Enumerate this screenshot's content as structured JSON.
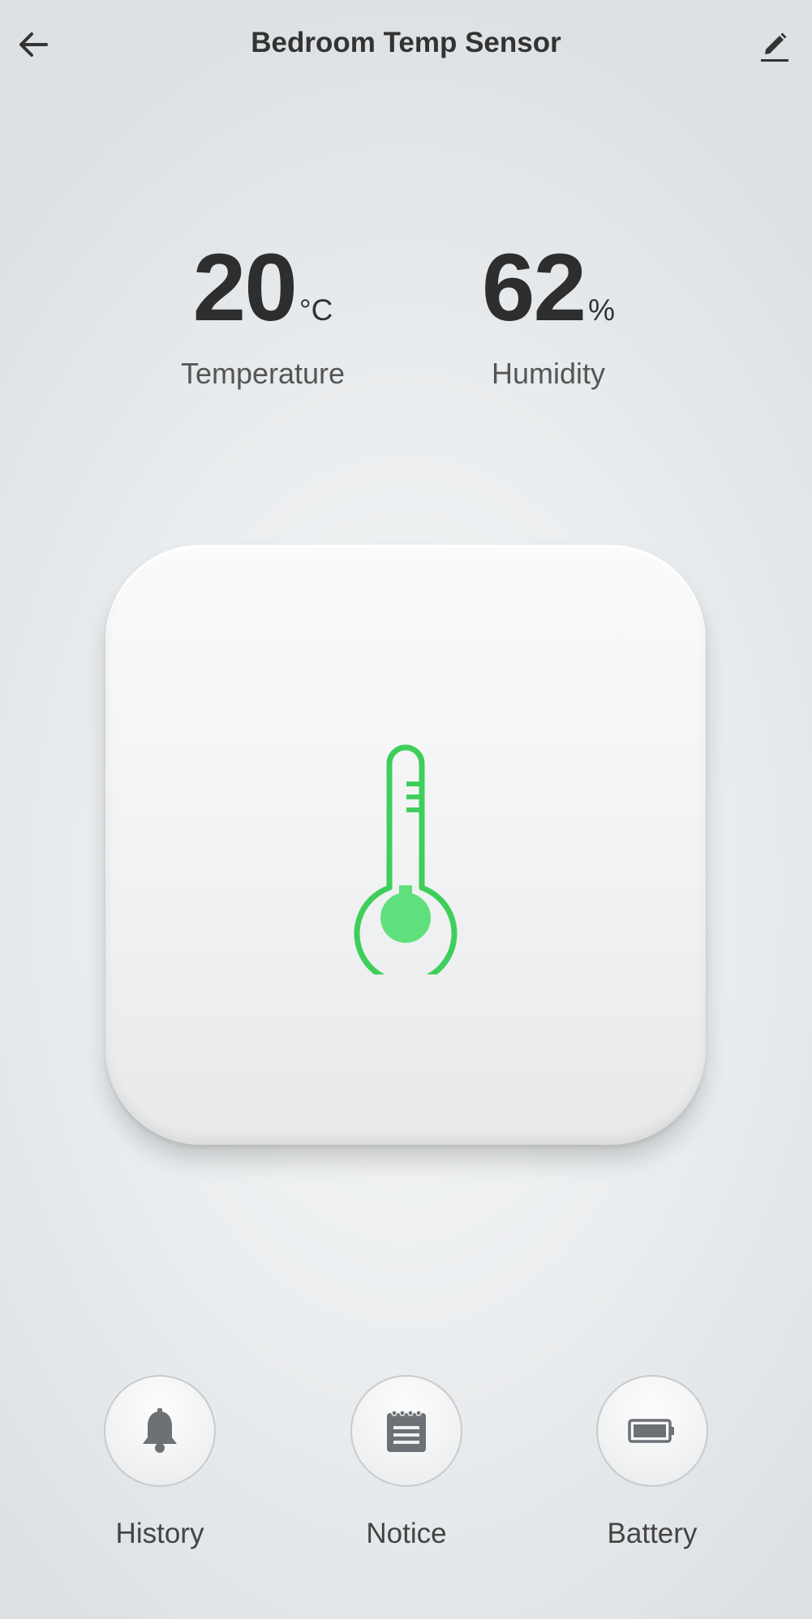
{
  "header": {
    "title": "Bedroom Temp Sensor",
    "back_icon": "arrow-left-icon",
    "edit_icon": "pencil-icon"
  },
  "readings": {
    "temperature": {
      "value": "20",
      "unit": "°C",
      "label": "Temperature"
    },
    "humidity": {
      "value": "62",
      "unit": "%",
      "label": "Humidity"
    }
  },
  "device": {
    "icon": "thermometer-icon",
    "accent_color": "#3ecf5b",
    "fill_color": "#5fe07c"
  },
  "actions": [
    {
      "label": "History",
      "icon": "bell-icon"
    },
    {
      "label": "Notice",
      "icon": "notepad-icon"
    },
    {
      "label": "Battery",
      "icon": "battery-icon"
    }
  ]
}
